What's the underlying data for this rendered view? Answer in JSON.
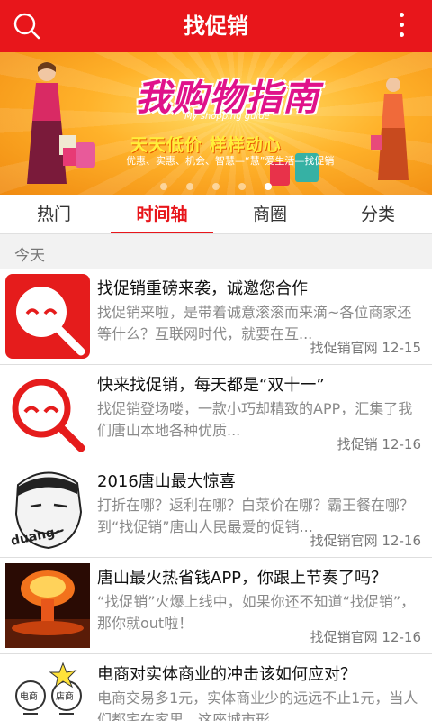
{
  "header": {
    "title": "找促销",
    "search_icon": "search-icon",
    "more_icon": "more-vertical-icon",
    "bg_color": "#e8161b"
  },
  "banner": {
    "headline": "我购物指南",
    "subtitle_en": "My shopping guide",
    "slogan": "天天低价 样样动心",
    "tagline": "优惠、实惠、机会、智慧—“慧”爱生活—找促销",
    "dots_count": 5,
    "active_dot": 4
  },
  "tabs": [
    {
      "label": "热门",
      "active": false
    },
    {
      "label": "时间轴",
      "active": true
    },
    {
      "label": "商圈",
      "active": false
    },
    {
      "label": "分类",
      "active": false
    }
  ],
  "section": {
    "label": "今天"
  },
  "items": [
    {
      "title": "找促销重磅来袭，诚邀您合作",
      "desc": "找促销来啦，是带着诚意滚滚而来滴~各位商家还等什么？互联网时代，就要在互...",
      "meta": "找促销官网 12-15",
      "thumb": "app-logo-filled"
    },
    {
      "title": "快来找促销，每天都是“双十一”",
      "desc": "找促销登场喽，一款小巧却精致的APP，汇集了我们唐山本地各种优质...",
      "meta": "找促销 12-16",
      "thumb": "app-logo-outline"
    },
    {
      "title": "2016唐山最大惊喜",
      "desc": "打折在哪？返利在哪？白菜价在哪？霸王餐在哪？到“找促销”唐山人民最爱的促销...",
      "meta": "找促销官网 12-16",
      "thumb": "meme-face",
      "thumb_text": "duang~"
    },
    {
      "title": "唐山最火热省钱APP，你跟上节奏了吗？",
      "desc": "“找促销”火爆上线中，如果你还不知道“找促销”，那你就out啦！",
      "meta": "找促销官网 12-16",
      "thumb": "explosion-image"
    },
    {
      "title": "电商对实体商业的冲击该如何应对？",
      "desc": "电商交易多1元，实体商业少的远远不止1元，当人们都宅在家里，这座城市形...",
      "meta": "",
      "thumb": "cartoon-sketch",
      "thumb_labels": [
        "电商",
        "店商"
      ]
    }
  ]
}
